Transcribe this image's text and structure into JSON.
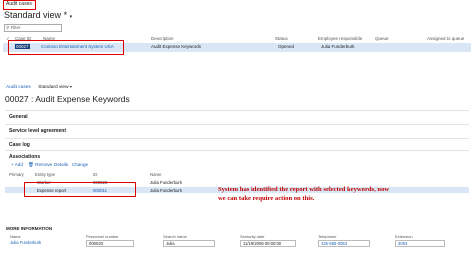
{
  "breadcrumb": "Audit cases",
  "view_title": "Standard view",
  "view_marker": "*",
  "filter_placeholder": "Filter",
  "grid": {
    "headers": [
      "Case ID",
      "Name",
      "Description",
      "Status",
      "Employee responsible",
      "Queue",
      "Assigned to queue"
    ],
    "row": {
      "case_id": "00027",
      "name": "Contoso Entertainment System USA",
      "description": "Audit Expense Keywords",
      "status": "Opened",
      "employee": "Julia Funderburk"
    }
  },
  "detail": {
    "breadcrumb_link": "Audit cases",
    "view_label": "Standard view",
    "title": "00027 : Audit Expense Keywords",
    "sections": [
      "General",
      "Service level agreement",
      "Case log",
      "Associations"
    ],
    "toolbar": {
      "add": "+ Add",
      "remove": "Remove",
      "details": "Details",
      "change": "Change"
    },
    "assoc_headers": [
      "Primary",
      "Entity type",
      "ID",
      "Name"
    ],
    "assoc_rows": [
      {
        "entity": "Worker",
        "id": "000020",
        "name": "Julia Funderburk"
      },
      {
        "entity": "Expense report",
        "id": "000011",
        "name": "Julia Funderburk"
      }
    ]
  },
  "annotation": "System has identified the report with selected keywords, now we can take require action on this.",
  "more_info": {
    "heading": "MORE INFORMATION",
    "fields": [
      {
        "label": "Name",
        "value": "Julia Funderburk",
        "link": true
      },
      {
        "label": "Personnel number",
        "value": "000020",
        "link": false
      },
      {
        "label": "Search name",
        "value": "Julia",
        "link": false
      },
      {
        "label": "Seniority date",
        "value": "11/19/2006 00:00:00",
        "link": false
      },
      {
        "label": "Telephone",
        "value": "425-555-0053",
        "link": true
      },
      {
        "label": "Extension",
        "value": "3053",
        "link": true
      }
    ]
  }
}
